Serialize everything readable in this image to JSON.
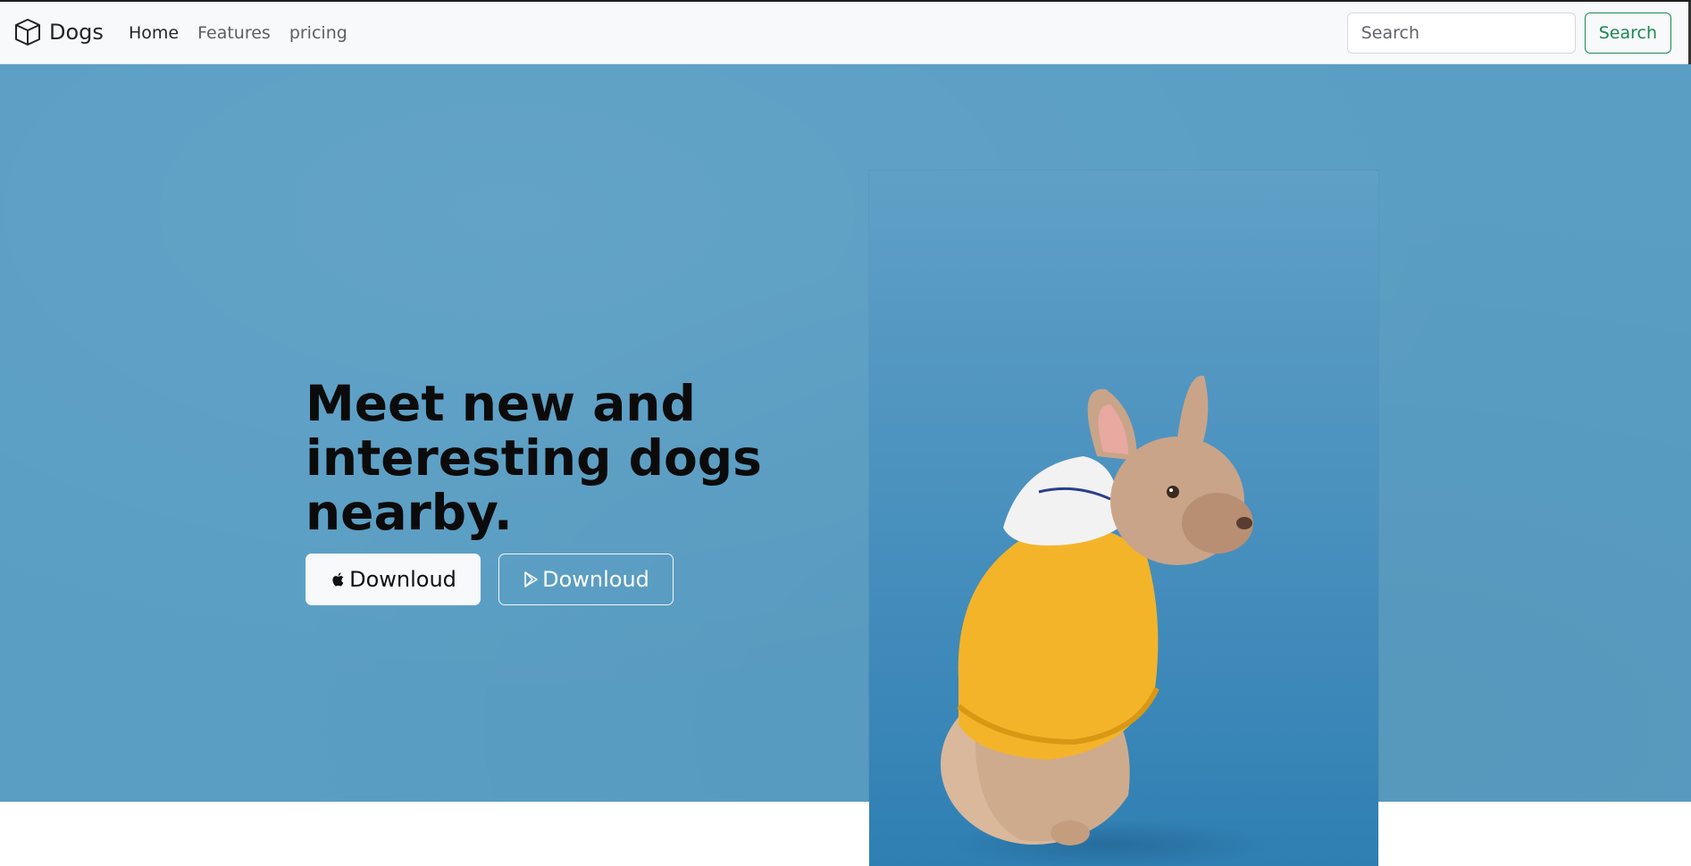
{
  "navbar": {
    "brand": "Dogs",
    "links": [
      {
        "label": "Home",
        "active": true
      },
      {
        "label": "Features",
        "active": false
      },
      {
        "label": "pricing",
        "active": false
      }
    ],
    "search": {
      "placeholder": "Search",
      "button_label": "Search"
    }
  },
  "hero": {
    "headline": "Meet new and interesting dogs nearby.",
    "buttons": [
      {
        "label": "Downloud",
        "icon": "apple-icon",
        "style": "light"
      },
      {
        "label": "Downloud",
        "icon": "google-play-icon",
        "style": "outline"
      }
    ],
    "image": {
      "subject": "french-bulldog-in-yellow-hoodie"
    }
  },
  "colors": {
    "hero_background": "#5a9ec4",
    "navbar_background": "#f8f9fa",
    "search_button": "#198754"
  }
}
